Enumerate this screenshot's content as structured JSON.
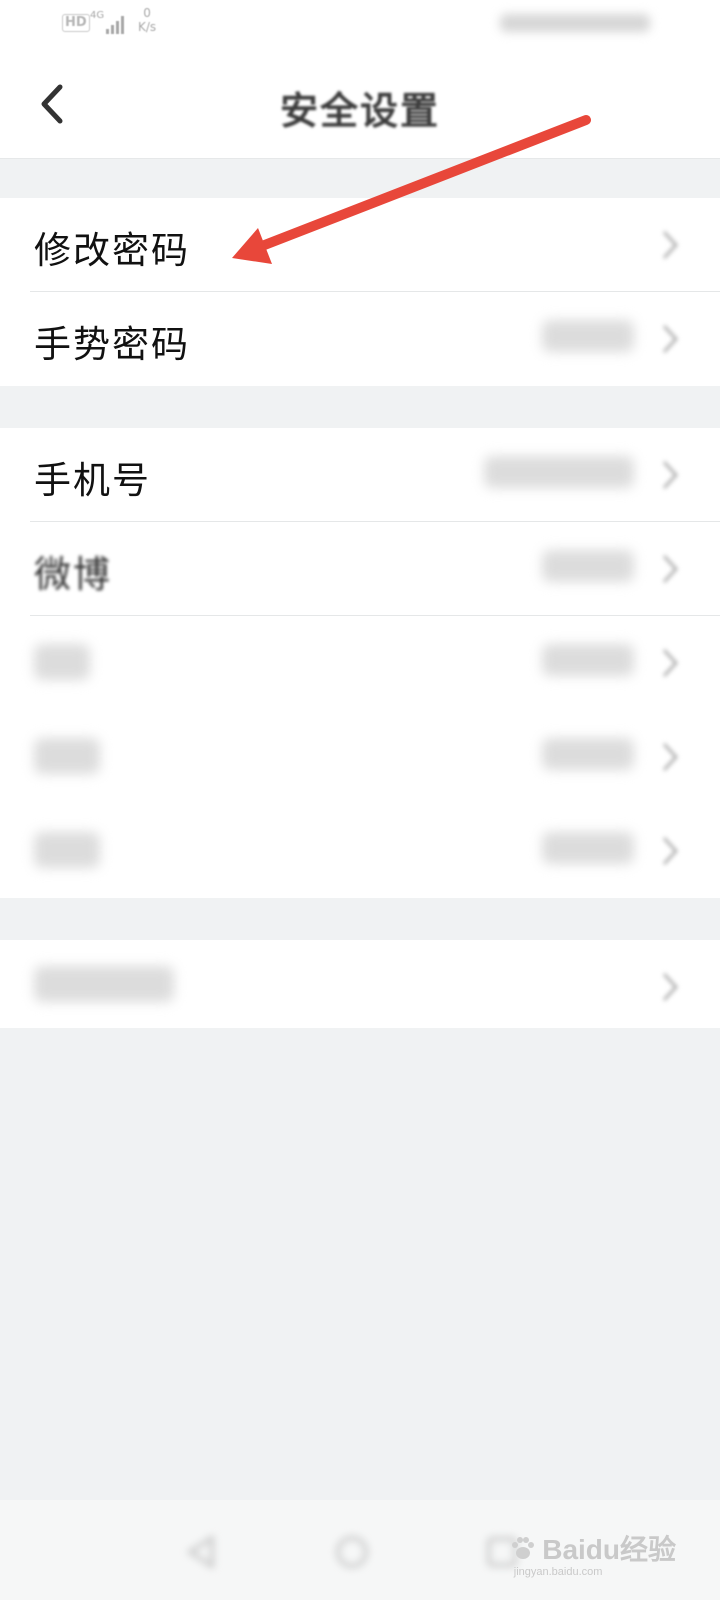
{
  "status_bar": {
    "hd_badge": "HD",
    "network": "4G",
    "speed_value": "0",
    "speed_unit": "K/s"
  },
  "header": {
    "title": "安全设置"
  },
  "groups": [
    {
      "rows": [
        {
          "label": "修改密码"
        },
        {
          "label": "手势密码"
        }
      ]
    },
    {
      "rows": [
        {
          "label": "手机号"
        },
        {
          "label": "微博"
        }
      ]
    }
  ],
  "watermark": {
    "brand": "Baidu经验",
    "site": "jingyan.baidu.com"
  },
  "colors": {
    "annotation_arrow": "#e8473a",
    "background": "#f0f2f3"
  },
  "icons": {
    "back": "chevron-left-icon",
    "row_chevron": "chevron-right-icon"
  }
}
